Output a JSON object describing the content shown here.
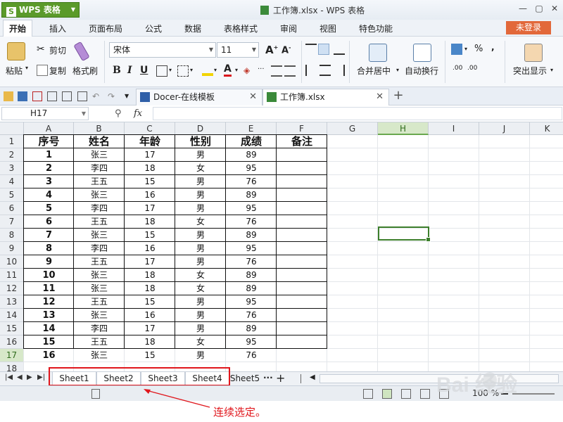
{
  "app": {
    "name": "WPS 表格",
    "window_title": "工作簿.xlsx - WPS 表格",
    "login_label": "未登录"
  },
  "menu": [
    "开始",
    "插入",
    "页面布局",
    "公式",
    "数据",
    "表格样式",
    "审阅",
    "视图",
    "特色功能"
  ],
  "ribbon": {
    "paste": "粘贴",
    "cut": "剪切",
    "copy": "复制",
    "format_painter": "格式刷",
    "font_name": "宋体",
    "font_size": "11",
    "merge_center": "合并居中",
    "wrap_text": "自动换行",
    "highlight": "突出显示",
    "percent": "%"
  },
  "tabs": [
    {
      "label": "Docer-在线模板"
    },
    {
      "label": "工作簿.xlsx"
    }
  ],
  "formula_bar": {
    "name_box": "H17",
    "fx": "fx",
    "value": ""
  },
  "columns": [
    "A",
    "B",
    "C",
    "D",
    "E",
    "F",
    "G",
    "H",
    "I",
    "J",
    "K"
  ],
  "selected_column": "H",
  "rows": [
    "1",
    "2",
    "3",
    "4",
    "5",
    "6",
    "7",
    "8",
    "9",
    "10",
    "11",
    "12",
    "13",
    "14",
    "15",
    "16",
    "17",
    "18"
  ],
  "selected_row": "17",
  "table": {
    "headers": [
      "序号",
      "姓名",
      "年龄",
      "性别",
      "成绩",
      "备注"
    ],
    "rows": [
      [
        "1",
        "张三",
        "17",
        "男",
        "89",
        ""
      ],
      [
        "2",
        "李四",
        "18",
        "女",
        "95",
        ""
      ],
      [
        "3",
        "王五",
        "15",
        "男",
        "76",
        ""
      ],
      [
        "4",
        "张三",
        "16",
        "男",
        "89",
        ""
      ],
      [
        "5",
        "李四",
        "17",
        "男",
        "95",
        ""
      ],
      [
        "6",
        "王五",
        "18",
        "女",
        "76",
        ""
      ],
      [
        "7",
        "张三",
        "15",
        "男",
        "89",
        ""
      ],
      [
        "8",
        "李四",
        "16",
        "男",
        "95",
        ""
      ],
      [
        "9",
        "王五",
        "17",
        "男",
        "76",
        ""
      ],
      [
        "10",
        "张三",
        "18",
        "女",
        "89",
        ""
      ],
      [
        "12",
        "王五",
        "15",
        "男",
        "95",
        ""
      ],
      [
        "13",
        "张三",
        "16",
        "男",
        "76",
        ""
      ],
      [
        "14",
        "李四",
        "17",
        "男",
        "89",
        ""
      ],
      [
        "15",
        "王五",
        "18",
        "女",
        "95",
        ""
      ],
      [
        "16",
        "张三",
        "15",
        "男",
        "76",
        ""
      ]
    ]
  },
  "row_11_values": [
    "11",
    "张三",
    "18",
    "女",
    "89",
    ""
  ],
  "sheets": [
    "Sheet1",
    "Sheet2",
    "Sheet3",
    "Sheet4",
    "Sheet5"
  ],
  "sheet_more": "···",
  "sheet_add": "+",
  "status": {
    "zoom": "100 %"
  },
  "annotation": "连续选定。",
  "watermark": "Bai 经验",
  "colors": {
    "accent_green": "#5a9a2a",
    "login_orange": "#e2683a",
    "annotation_red": "#e0161c",
    "selection_green": "#3d7f2c"
  }
}
